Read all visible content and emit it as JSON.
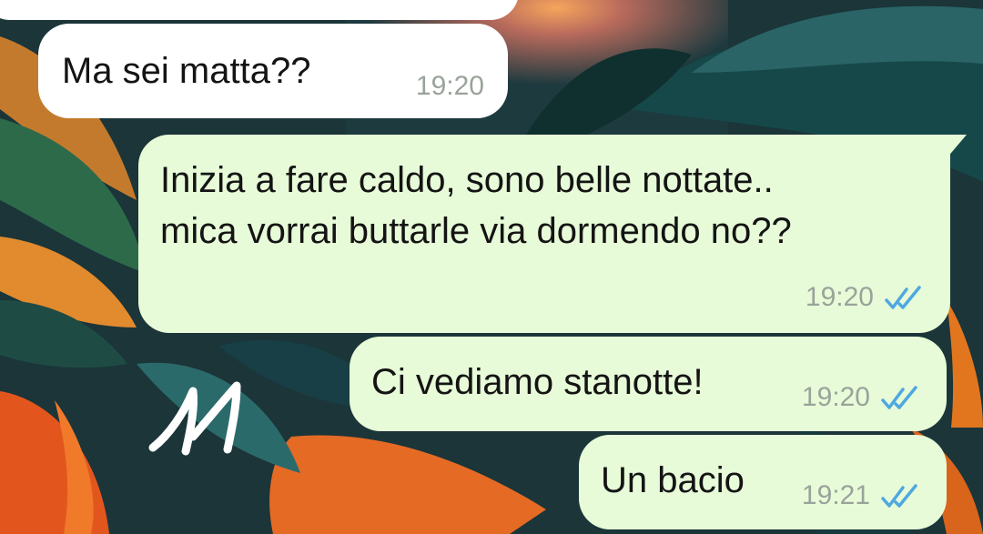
{
  "messages": [
    {
      "direction": "incoming",
      "text": "Ma sei matta??",
      "time": "19:20"
    },
    {
      "direction": "outgoing",
      "lines": [
        "Inizia a fare caldo, sono belle nottate..",
        "mica vorrai buttarle via dormendo no??"
      ],
      "time": "19:20",
      "status_icon": "double-check-icon",
      "status": "read"
    },
    {
      "direction": "outgoing",
      "text": "Ci vediamo stanotte!",
      "time": "19:20",
      "status_icon": "double-check-icon",
      "status": "read"
    },
    {
      "direction": "outgoing",
      "text": "Un bacio",
      "time": "19:21",
      "status_icon": "double-check-icon",
      "status": "read"
    }
  ],
  "colors": {
    "incoming_bubble": "#ffffff",
    "outgoing_bubble": "#e7fbd8",
    "timestamp": "#9aa39a",
    "read_ticks": "#4fa8e0"
  }
}
